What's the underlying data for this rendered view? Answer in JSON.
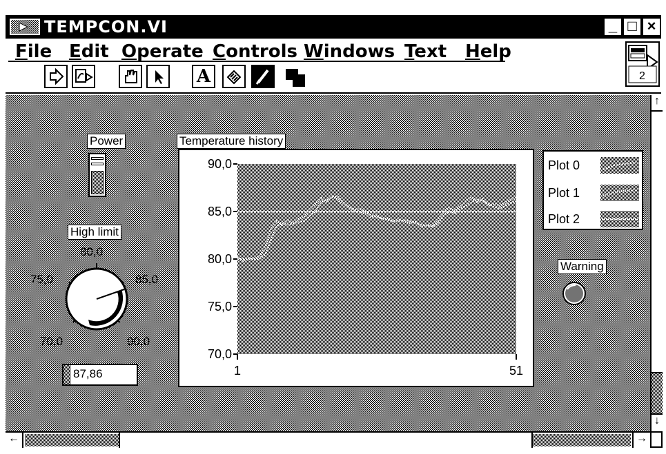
{
  "window": {
    "title": "TEMPCON.VI",
    "minimize_glyph": "_",
    "maximize_glyph": "□",
    "close_glyph": "×"
  },
  "menu": {
    "items": [
      {
        "label": "File",
        "u": "F",
        "rest": "ile"
      },
      {
        "label": "Edit",
        "u": "E",
        "rest": "dit"
      },
      {
        "label": "Operate",
        "u": "O",
        "rest": "perate"
      },
      {
        "label": "Controls",
        "u": "C",
        "rest": "ontrols"
      },
      {
        "label": "Windows",
        "u": "W",
        "rest": "indows"
      },
      {
        "label": "Text",
        "u": "T",
        "rest": "ext"
      },
      {
        "label": "Help",
        "u": "H",
        "rest": "elp"
      }
    ]
  },
  "toolbar": {
    "tools": [
      "run-arrow-icon",
      "run-continuously-icon",
      "operate-hand-icon",
      "position-arrow-icon",
      "label-text-icon",
      "wiring-spool-icon",
      "color-brush-icon",
      "color-swatch-icon"
    ],
    "text_tool_glyph": "A"
  },
  "vi_icon": {
    "number": "2"
  },
  "controls": {
    "power": {
      "label": "Power",
      "state": "off"
    },
    "high_limit": {
      "label": "High limit",
      "scale": [
        "70,0",
        "75,0",
        "80,0",
        "85,0",
        "90,0"
      ],
      "value": 87.86,
      "digital": "87,86"
    },
    "warning": {
      "label": "Warning",
      "state": "off"
    }
  },
  "chart_data": {
    "type": "line",
    "title": "Temperature history",
    "xlabel": "",
    "ylabel": "",
    "xlim": [
      1,
      51
    ],
    "ylim": [
      70,
      90
    ],
    "x_ticks": [
      "1",
      "51"
    ],
    "y_ticks": [
      "90,0",
      "85,0",
      "80,0",
      "75,0",
      "70,0"
    ],
    "legend_position": "right",
    "series": [
      {
        "name": "Plot 0",
        "x": [
          1,
          2,
          3,
          4,
          5,
          6,
          7,
          8,
          9,
          10,
          11,
          12,
          13,
          14,
          15,
          16,
          17,
          18,
          19,
          20,
          21,
          22,
          23,
          24,
          25,
          26,
          27,
          28,
          29,
          30,
          31,
          32,
          33,
          34,
          35,
          36,
          37,
          38,
          39,
          40,
          41,
          42,
          43,
          44,
          45,
          46,
          47,
          48,
          49,
          50,
          51
        ],
        "values": [
          80.0,
          80.0,
          80.0,
          80.0,
          80.0,
          80.5,
          82.0,
          83.4,
          83.8,
          83.6,
          83.7,
          83.9,
          84.0,
          84.6,
          85.0,
          86.0,
          86.2,
          86.5,
          86.6,
          86.0,
          85.5,
          85.2,
          85.3,
          85.0,
          84.6,
          84.4,
          84.3,
          84.1,
          84.0,
          84.0,
          84.1,
          84.0,
          83.8,
          83.6,
          83.5,
          83.4,
          83.7,
          84.6,
          85.0,
          84.8,
          85.3,
          85.6,
          86.0,
          86.3,
          86.1,
          85.8,
          85.5,
          85.3,
          85.6,
          85.9,
          86.1
        ]
      },
      {
        "name": "Plot 1",
        "x": [
          1,
          2,
          3,
          4,
          5,
          6,
          7,
          8,
          9,
          10,
          11,
          12,
          13,
          14,
          15,
          16,
          17,
          18,
          19,
          20,
          21,
          22,
          23,
          24,
          25,
          26,
          27,
          28,
          29,
          30,
          31,
          32,
          33,
          34,
          35,
          36,
          37,
          38,
          39,
          40,
          41,
          42,
          43,
          44,
          45,
          46,
          47,
          48,
          49,
          50,
          51
        ],
        "values": [
          80.2,
          79.8,
          80.1,
          80.0,
          80.3,
          81.2,
          83.1,
          84.0,
          83.6,
          84.1,
          83.8,
          84.2,
          84.5,
          85.2,
          85.8,
          86.4,
          86.0,
          86.7,
          86.3,
          85.7,
          85.4,
          85.1,
          84.9,
          84.8,
          84.4,
          84.6,
          84.2,
          84.3,
          83.9,
          84.2,
          83.9,
          83.8,
          83.9,
          83.4,
          83.6,
          83.5,
          84.1,
          85.0,
          85.4,
          85.1,
          85.6,
          86.1,
          86.5,
          86.0,
          86.3,
          85.6,
          85.8,
          85.6,
          85.9,
          86.3,
          86.5
        ]
      },
      {
        "name": "Plot 2",
        "x": [
          1,
          51
        ],
        "values": [
          84.97,
          84.97
        ]
      }
    ]
  },
  "legend": {
    "items": [
      "Plot 0",
      "Plot 1",
      "Plot 2"
    ]
  },
  "scroll": {
    "up": "↑",
    "down": "↓",
    "left": "←",
    "right": "→"
  }
}
